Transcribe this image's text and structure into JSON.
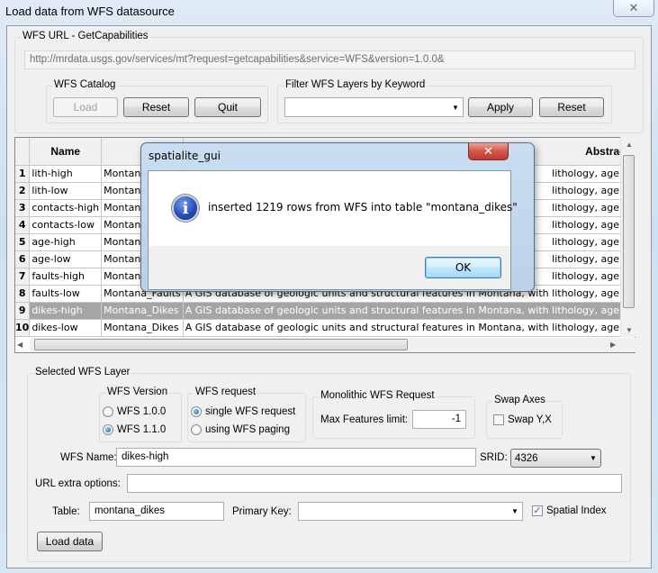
{
  "window": {
    "title": "Load data from WFS datasource",
    "close_icon": "close-icon"
  },
  "url_group": {
    "label": "WFS URL - GetCapabilities",
    "url": "http://mrdata.usgs.gov/services/mt?request=getcapabilities&service=WFS&version=1.0.0&"
  },
  "catalog_group": {
    "label": "WFS Catalog",
    "load_label": "Load",
    "reset_label": "Reset",
    "quit_label": "Quit"
  },
  "filter_group": {
    "label": "Filter WFS Layers by Keyword",
    "keyword_value": "",
    "apply_label": "Apply",
    "reset_label": "Reset"
  },
  "layers_grid": {
    "columns": [
      "Name",
      "",
      "Abstract"
    ],
    "rows": [
      {
        "num": "1",
        "name": "lith-high",
        "title": "Montana",
        "abstract": "lithology, age, data stru"
      },
      {
        "num": "2",
        "name": "lith-low",
        "title": "Montana",
        "abstract": "lithology, age, data stru"
      },
      {
        "num": "3",
        "name": "contacts-high",
        "title": "Montana",
        "abstract": "lithology, age, data stru"
      },
      {
        "num": "4",
        "name": "contacts-low",
        "title": "Montana",
        "abstract": "lithology, age, data stru"
      },
      {
        "num": "5",
        "name": "age-high",
        "title": "Montana",
        "abstract": "lithology, age, data stru"
      },
      {
        "num": "6",
        "name": "age-low",
        "title": "Montana",
        "abstract": "lithology, age, data stru"
      },
      {
        "num": "7",
        "name": "faults-high",
        "title": "Montana",
        "abstract": "lithology, age, data stru"
      },
      {
        "num": "8",
        "name": "faults-low",
        "title": "Montana_Faults",
        "abstract": "A GIS database of geologic units and structural features in Montana, with lithology, age, data stru"
      },
      {
        "num": "9",
        "name": "dikes-high",
        "title": "Montana_Dikes",
        "abstract": "A GIS database of geologic units and structural features in Montana, with lithology, age, data stru"
      },
      {
        "num": "10",
        "name": "dikes-low",
        "title": "Montana_Dikes",
        "abstract": "A GIS database of geologic units and structural features in Montana, with lithology, age, data stru"
      }
    ],
    "selected_row": 9
  },
  "selected_layer": {
    "label": "Selected WFS Layer",
    "version_group": {
      "label": "WFS Version",
      "options": [
        "WFS 1.0.0",
        "WFS 1.1.0"
      ],
      "selected": "WFS 1.1.0"
    },
    "request_group": {
      "label": "WFS request",
      "options": [
        "single WFS request",
        "using WFS paging"
      ],
      "selected": "single WFS request"
    },
    "monolithic_group": {
      "label": "Monolithic WFS Request",
      "max_features_label": "Max Features limit:",
      "max_features_value": "-1"
    },
    "swap_group": {
      "label": "Swap Axes",
      "swap_label": "Swap Y,X",
      "swap_checked": false
    },
    "wfs_name_label": "WFS Name:",
    "wfs_name_value": "dikes-high",
    "srid_label": "SRID:",
    "srid_value": "4326",
    "url_extra_label": "URL extra options:",
    "url_extra_value": "",
    "table_label": "Table:",
    "table_value": "montana_dikes",
    "primary_key_label": "Primary Key:",
    "primary_key_value": "",
    "spatial_index_label": "Spatial Index",
    "spatial_index_checked": true,
    "load_data_label": "Load data"
  },
  "message_box": {
    "title": "spatialite_gui",
    "icon": "info-icon",
    "message": "inserted 1219 rows from WFS into table \"montana_dikes\"",
    "ok_label": "OK"
  }
}
